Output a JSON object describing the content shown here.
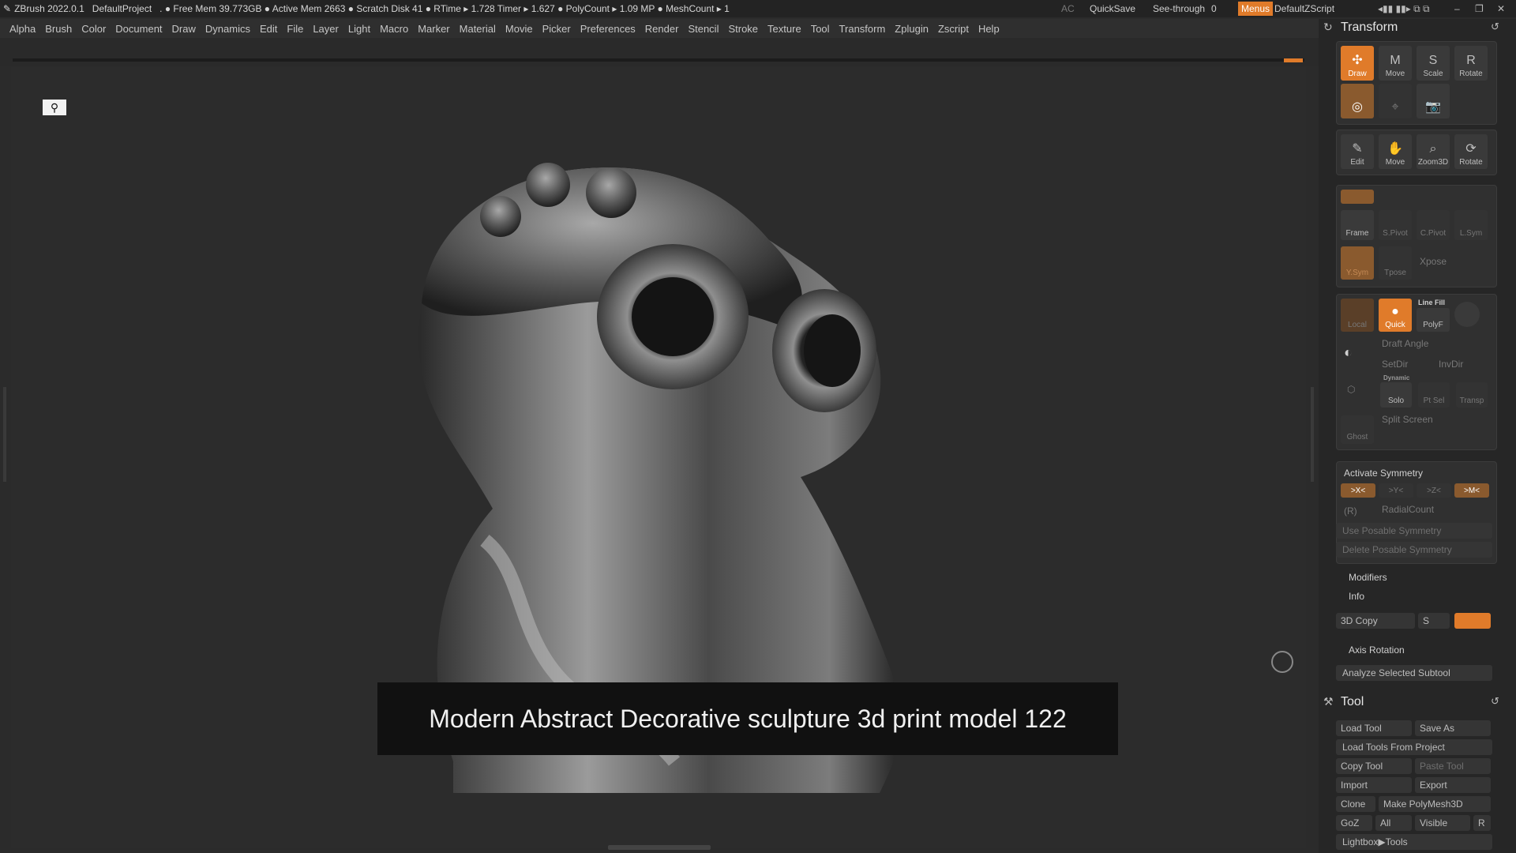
{
  "titlebar": {
    "app": "ZBrush 2022.0.1",
    "project": "DefaultProject",
    "stats": ". ● Free Mem 39.773GB ● Active Mem 2663 ● Scratch Disk 41 ● RTime ▸ 1.728 Timer ▸ 1.627 ● PolyCount ▸ 1.09 MP ● MeshCount ▸ 1",
    "ac": "AC",
    "quicksave": "QuickSave",
    "seethrough": "See-through",
    "seethrough_value": "0",
    "menus": "Menus",
    "zscript": "DefaultZScript"
  },
  "menu": [
    "Alpha",
    "Brush",
    "Color",
    "Document",
    "Draw",
    "Dynamics",
    "Edit",
    "File",
    "Layer",
    "Light",
    "Macro",
    "Marker",
    "Material",
    "Movie",
    "Picker",
    "Preferences",
    "Render",
    "Stencil",
    "Stroke",
    "Texture",
    "Tool",
    "Transform",
    "Zplugin",
    "Zscript",
    "Help"
  ],
  "caption": "Modern Abstract Decorative sculpture 3d print model 122",
  "transform": {
    "title": "Transform",
    "row1": [
      "Draw",
      "Move",
      "Scale",
      "Rotate"
    ],
    "row3": [
      "Edit",
      "Move",
      "Zoom3D",
      "Rotate"
    ],
    "sym_row": [
      "Frame",
      "S.Pivot",
      "C.Pivot",
      "L.Sym"
    ],
    "xpose_row": [
      "Y.Sym",
      "Tpose",
      "Xpose"
    ],
    "poly_row": [
      "Local",
      "Quick",
      "PolyF"
    ],
    "line_fill": "Line Fill",
    "draft_angle": "Draft Angle",
    "setdir": "SetDir",
    "invdir": "InvDir",
    "dynamic": "Dynamic",
    "solo_row": [
      "Solo",
      "Pt Sel",
      "Transp"
    ],
    "split_screen": "Split Screen",
    "ghost": "Ghost",
    "activate_symmetry": "Activate Symmetry",
    "axes": [
      ">X<",
      ">Y<",
      ">Z<",
      ">M<"
    ],
    "r": "(R)",
    "radial_count": "RadialCount",
    "use_posable": "Use Posable Symmetry",
    "delete_posable": "Delete Posable Symmetry",
    "modifiers": "Modifiers",
    "info": "Info",
    "copy3d": "3D Copy",
    "s": "S",
    "axis_rotation": "Axis Rotation",
    "analyze": "Analyze Selected Subtool"
  },
  "tool": {
    "title": "Tool",
    "load_tool": "Load Tool",
    "save_as": "Save As",
    "load_from_project": "Load Tools From Project",
    "copy_tool": "Copy Tool",
    "paste_tool": "Paste Tool",
    "import": "Import",
    "export": "Export",
    "clone": "Clone",
    "make_polymesh": "Make PolyMesh3D",
    "goz": "GoZ",
    "all": "All",
    "visible": "Visible",
    "r": "R",
    "lightbox": "Lightbox▶Tools"
  },
  "colors": {
    "accent": "#e07b2a",
    "bg": "#2b2b2b",
    "panel": "#262626"
  }
}
